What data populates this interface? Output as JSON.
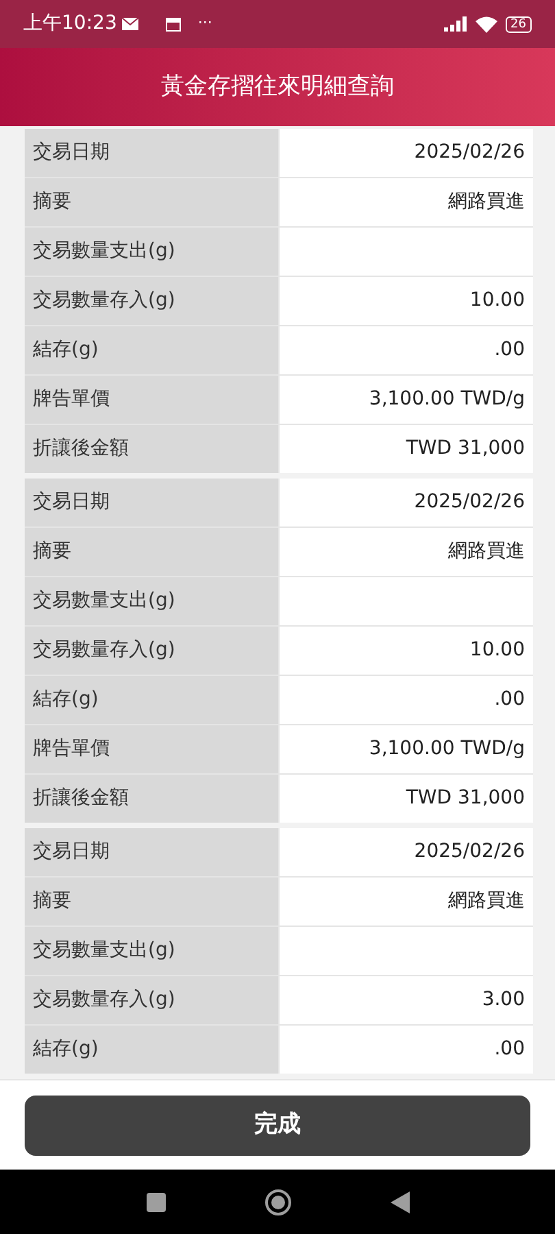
{
  "status_bar": {
    "time": "上午10:23",
    "dots": "···",
    "battery": "26"
  },
  "header": {
    "title": "黃金存摺往來明細查詢"
  },
  "records": [
    {
      "rows": [
        {
          "label": "交易日期",
          "value": "2025/02/26"
        },
        {
          "label": "摘要",
          "value": "網路買進"
        },
        {
          "label": "交易數量支出(g)",
          "value": ""
        },
        {
          "label": "交易數量存入(g)",
          "value": "10.00"
        },
        {
          "label": "結存(g)",
          "value": ".00"
        },
        {
          "label": "牌告單價",
          "value": "3,100.00 TWD/g"
        },
        {
          "label": "折讓後金額",
          "value": "TWD 31,000"
        }
      ]
    },
    {
      "rows": [
        {
          "label": "交易日期",
          "value": "2025/02/26"
        },
        {
          "label": "摘要",
          "value": "網路買進"
        },
        {
          "label": "交易數量支出(g)",
          "value": ""
        },
        {
          "label": "交易數量存入(g)",
          "value": "10.00"
        },
        {
          "label": "結存(g)",
          "value": ".00"
        },
        {
          "label": "牌告單價",
          "value": "3,100.00 TWD/g"
        },
        {
          "label": "折讓後金額",
          "value": "TWD 31,000"
        }
      ]
    },
    {
      "rows": [
        {
          "label": "交易日期",
          "value": "2025/02/26"
        },
        {
          "label": "摘要",
          "value": "網路買進"
        },
        {
          "label": "交易數量支出(g)",
          "value": ""
        },
        {
          "label": "交易數量存入(g)",
          "value": "3.00"
        },
        {
          "label": "結存(g)",
          "value": ".00"
        }
      ]
    }
  ],
  "done_button": {
    "label": "完成"
  }
}
